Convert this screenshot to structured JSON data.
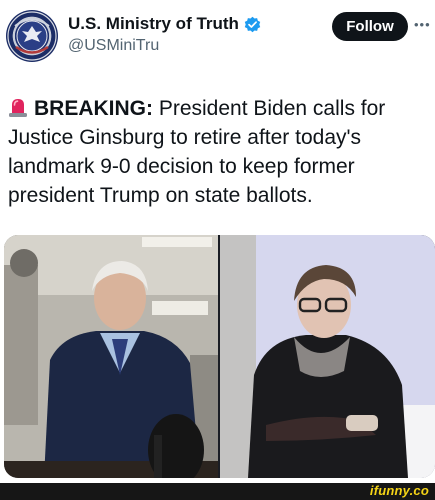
{
  "account": {
    "display_name": "U.S. Ministry of Truth",
    "handle": "@USMiniTru",
    "verified": true,
    "avatar_icon": "ministry-seal-icon"
  },
  "actions": {
    "follow_label": "Follow",
    "more_icon": "more-dots-icon"
  },
  "tweet": {
    "emoji_icon": "police-siren-icon",
    "breaking_label": "BREAKING:",
    "body": " President Biden calls for Justice Ginsburg to retire after today's landmark 9-0 decision to keep former president Trump on state ballots."
  },
  "media": {
    "left_photo": "joe-biden-photo",
    "right_photo": "ruth-bader-ginsburg-photo"
  },
  "footer": {
    "watermark": "ifunny.co"
  },
  "colors": {
    "follow_bg": "#0f1419",
    "verified": "#1d9bf0",
    "handle": "#536471",
    "watermark": "#f5d416"
  }
}
